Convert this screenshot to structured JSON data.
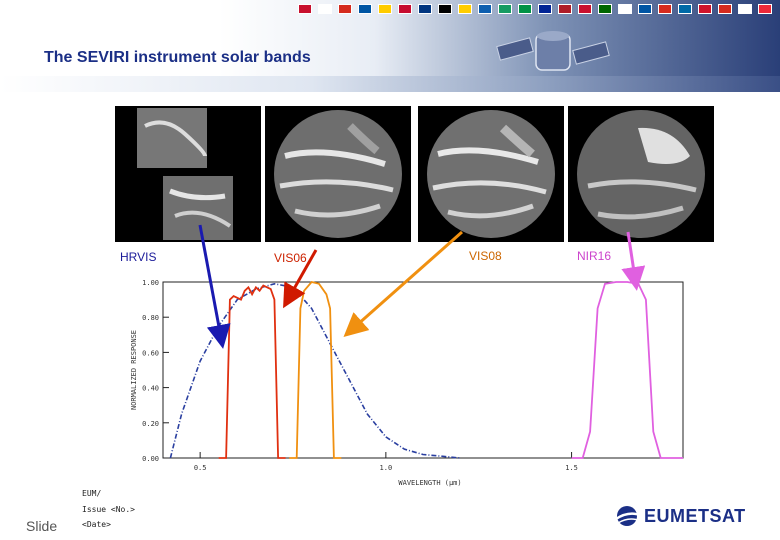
{
  "slide": {
    "title": "The SEVIRI instrument solar bands",
    "footer": {
      "eum": "EUM/",
      "issue": "Issue <No.>",
      "date": "<Date>",
      "slide_label": "Slide"
    },
    "logo_text": "EUMETSAT",
    "flag_colors": [
      "#c8102e",
      "#ffffff",
      "#d52b1e",
      "#0055a4",
      "#ffcc00",
      "#c60c30",
      "#003580",
      "#000000",
      "#ffcd00",
      "#0d5eaf",
      "#169b62",
      "#009246",
      "#002395",
      "#ae1c28",
      "#c8102e",
      "#006600",
      "#ffffff",
      "#0055a4",
      "#d52b1e",
      "#006aa7",
      "#cf142b",
      "#d52b1e",
      "#ffffff",
      "#ed2939"
    ],
    "bands": [
      {
        "label": "HRVIS",
        "color": "#1a1a99"
      },
      {
        "label": "VIS06",
        "color": "#cc2200"
      },
      {
        "label": "VIS08",
        "color": "#cc6600"
      },
      {
        "label": "NIR16",
        "color": "#cc44cc"
      }
    ]
  },
  "chart_data": {
    "type": "line",
    "title": "",
    "xlabel": "WAVELENGTH (μm)",
    "ylabel": "NORMALIZED RESPONSE",
    "xlim": [
      0.4,
      1.8
    ],
    "ylim": [
      0.0,
      1.0
    ],
    "x_ticks": [
      "0.5",
      "1.0",
      "1.5"
    ],
    "y_ticks": [
      "0.00",
      "0.20",
      "0.40",
      "0.60",
      "0.80",
      "1.00"
    ],
    "series": [
      {
        "name": "HRVIS",
        "color": "#2a3fa0",
        "dash": true,
        "x": [
          0.42,
          0.45,
          0.5,
          0.55,
          0.6,
          0.65,
          0.7,
          0.75,
          0.8,
          0.85,
          0.9,
          0.95,
          1.0,
          1.05,
          1.1,
          1.15,
          1.2
        ],
        "y": [
          0.0,
          0.25,
          0.55,
          0.75,
          0.9,
          0.96,
          0.99,
          0.97,
          0.85,
          0.65,
          0.45,
          0.25,
          0.12,
          0.05,
          0.02,
          0.01,
          0.0
        ]
      },
      {
        "name": "VIS06",
        "color": "#e03010",
        "dash": false,
        "x": [
          0.55,
          0.57,
          0.58,
          0.59,
          0.61,
          0.62,
          0.63,
          0.64,
          0.65,
          0.66,
          0.67,
          0.69,
          0.7,
          0.71,
          0.73
        ],
        "y": [
          0.0,
          0.0,
          0.9,
          0.92,
          0.9,
          0.95,
          0.97,
          0.93,
          0.97,
          0.95,
          0.98,
          0.96,
          0.9,
          0.0,
          0.0
        ]
      },
      {
        "name": "VIS08",
        "color": "#f09010",
        "dash": false,
        "x": [
          0.74,
          0.76,
          0.77,
          0.78,
          0.8,
          0.82,
          0.84,
          0.85,
          0.86,
          0.88
        ],
        "y": [
          0.0,
          0.0,
          0.85,
          0.95,
          1.0,
          0.99,
          0.93,
          0.85,
          0.0,
          0.0
        ]
      },
      {
        "name": "NIR16",
        "color": "#e060e0",
        "dash": false,
        "x": [
          1.5,
          1.53,
          1.55,
          1.57,
          1.59,
          1.62,
          1.65,
          1.68,
          1.7,
          1.72,
          1.74,
          1.8
        ],
        "y": [
          0.0,
          0.0,
          0.15,
          0.85,
          0.99,
          1.0,
          1.0,
          0.99,
          0.9,
          0.15,
          0.0,
          0.0
        ]
      }
    ]
  }
}
